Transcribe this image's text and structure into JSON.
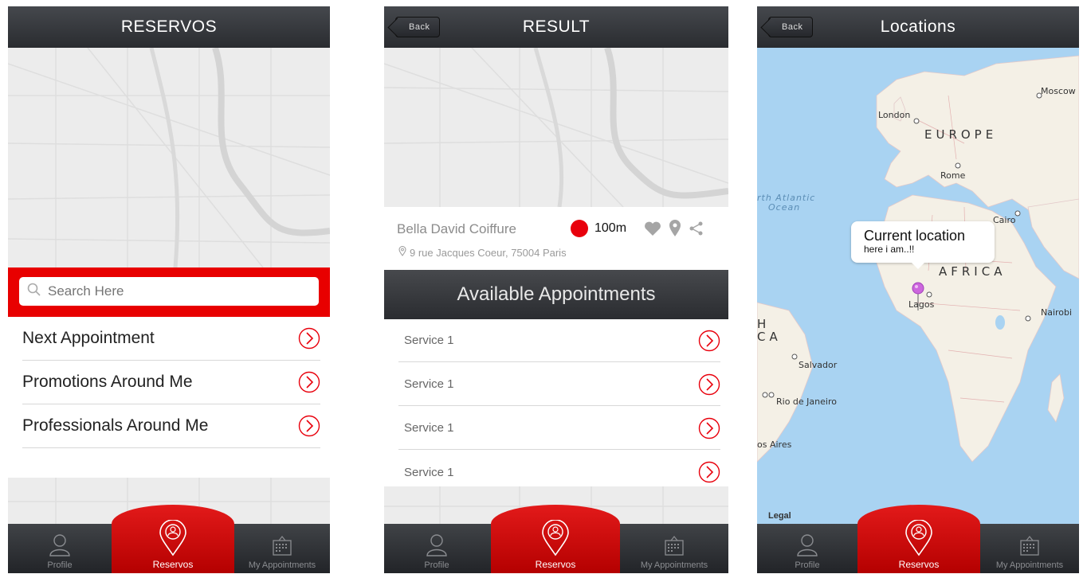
{
  "screen1": {
    "title": "RESERVOS",
    "search_placeholder": "Search Here",
    "menu": [
      {
        "label": "Next Appointment"
      },
      {
        "label": "Promotions Around Me"
      },
      {
        "label": "Professionals Around Me"
      }
    ]
  },
  "screen2": {
    "title": "RESULT",
    "back_label": "Back",
    "shop": {
      "name": "Bella David Coiffure",
      "distance": "100m",
      "address": "9 rue Jacques Coeur, 75004 Paris"
    },
    "appointments_header": "Available Appointments",
    "services": [
      {
        "label": "Service 1"
      },
      {
        "label": "Service 1"
      },
      {
        "label": "Service 1"
      },
      {
        "label": "Service 1"
      }
    ]
  },
  "screen3": {
    "title": "Locations",
    "back_label": "Back",
    "callout": {
      "title": "Current location",
      "subtitle": "here i am..!!"
    },
    "legal": "Legal",
    "labels": {
      "moscow": "Moscow",
      "london": "London",
      "europe": "EUROPE",
      "rome": "Rome",
      "cairo": "Cairo",
      "africa": "AFRICA",
      "lagos": "Lagos",
      "nairobi": "Nairobi",
      "salvador": "Salvador",
      "rio": "Rio de Janeiro",
      "aires": "os Aires",
      "ocean1": "rth Atlantic",
      "ocean2": "Ocean",
      "sa1": "H",
      "sa2": "CA"
    }
  },
  "tabbar": {
    "profile": "Profile",
    "reservos": "Reservos",
    "appointments": "My Appointments"
  },
  "colors": {
    "accent_red": "#e80000",
    "navbar": "#2d2f33",
    "map_bg": "#ececec",
    "ocean": "#a9d3f2",
    "land": "#f4f0e6",
    "pin": "#cc66dd"
  }
}
